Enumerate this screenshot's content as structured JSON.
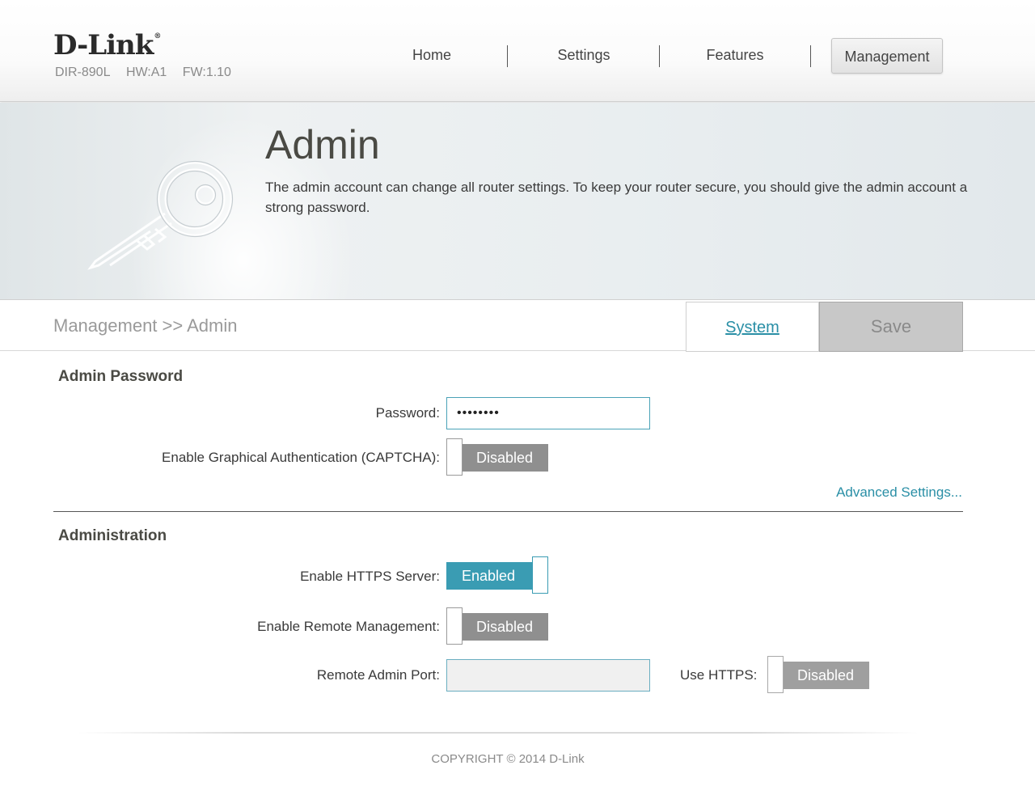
{
  "header": {
    "logo": "D-Link",
    "logo_mark": "®",
    "model": "DIR-890L",
    "hw": "HW:A1",
    "fw": "FW:1.10"
  },
  "nav": {
    "items": [
      {
        "label": "Home"
      },
      {
        "label": "Settings"
      },
      {
        "label": "Features"
      },
      {
        "label": "Management",
        "active": true
      }
    ]
  },
  "banner": {
    "title": "Admin",
    "description": "The admin account can change all router settings. To keep your router secure, you should give the admin account a strong password.",
    "icon": "key-icon"
  },
  "toolbar": {
    "breadcrumb": "Management >> Admin",
    "system_label": "System",
    "save_label": "Save"
  },
  "admin_password": {
    "section_title": "Admin Password",
    "password_label": "Password:",
    "password_value": "••••••••",
    "captcha_label": "Enable Graphical Authentication (CAPTCHA):",
    "captcha_state": "Disabled",
    "advanced_link": "Advanced Settings..."
  },
  "administration": {
    "section_title": "Administration",
    "https_label": "Enable HTTPS Server:",
    "https_state": "Enabled",
    "remote_label": "Enable Remote Management:",
    "remote_state": "Disabled",
    "port_label": "Remote Admin Port:",
    "port_value": "",
    "use_https_label": "Use HTTPS:",
    "use_https_state": "Disabled"
  },
  "footer": {
    "copyright": "COPYRIGHT © 2014 D-Link"
  },
  "colors": {
    "accent": "#3a9cb3",
    "link": "#2a8fa6",
    "toggle_off": "#8f8f8f",
    "save_bg": "#c8c8c8"
  }
}
